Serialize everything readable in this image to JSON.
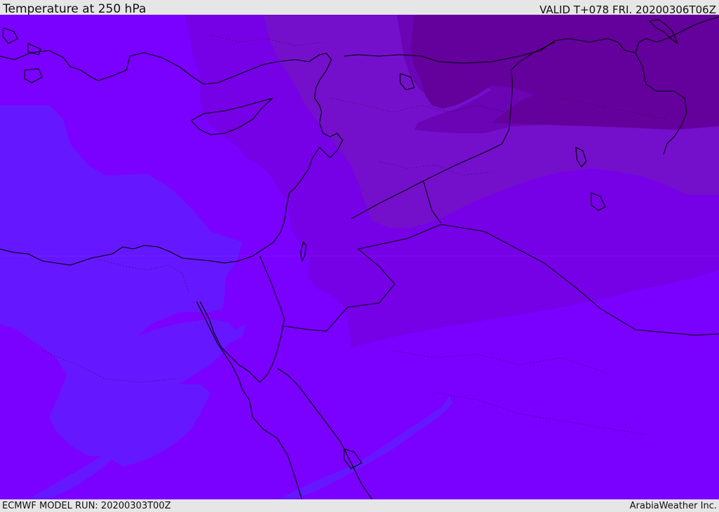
{
  "header": {
    "title": "Temperature at 250 hPa",
    "valid_time": "VALID T+078 FRI. 20200306T06Z"
  },
  "footer": {
    "model_run": "ECMWF MODEL RUN: 20200303T00Z",
    "credit": "ArabiaWeather Inc."
  },
  "map": {
    "variable": "Temperature at 250 hPa",
    "colors": {
      "base_violet": "#7a00ff",
      "cool_blue_violet": "#6518ff",
      "purple": "#7600e6",
      "medium_purple": "#7410cc",
      "dark_purple": "#6a04b4",
      "darkest_purple": "#64009c",
      "coastline": "#000000"
    }
  }
}
